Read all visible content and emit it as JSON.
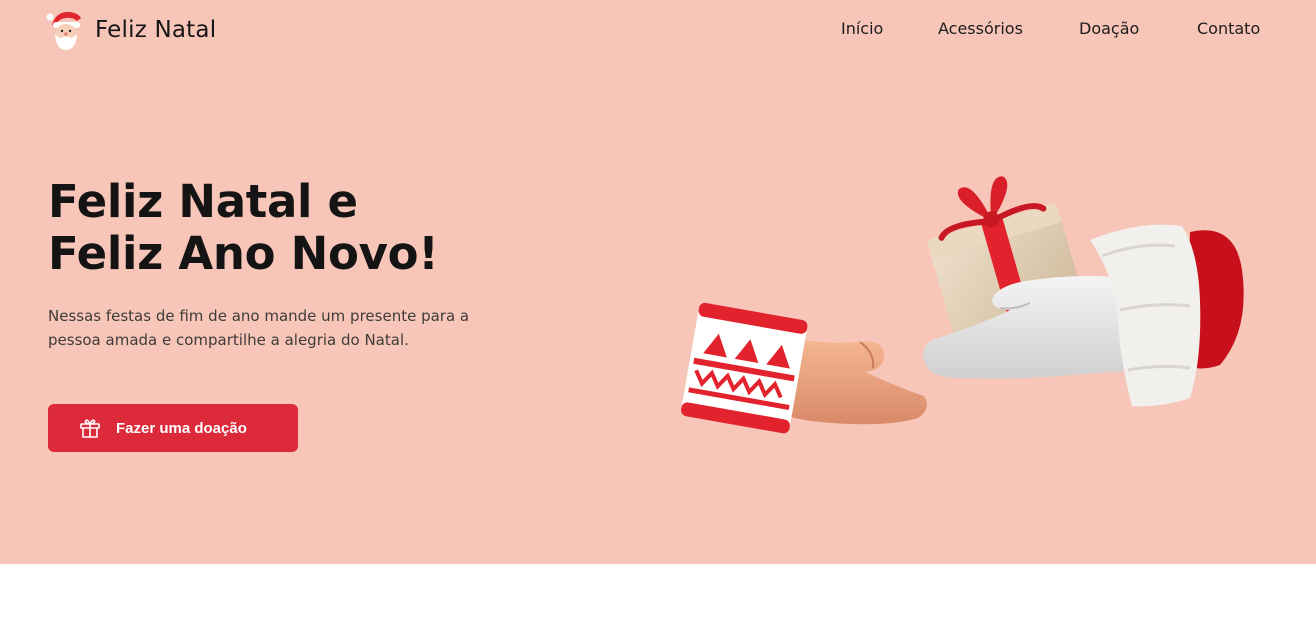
{
  "brand": {
    "name": "Feliz Natal",
    "logo_icon": "santa-icon"
  },
  "nav": {
    "items": [
      {
        "label": "Início"
      },
      {
        "label": "Acessórios"
      },
      {
        "label": "Doação"
      },
      {
        "label": "Contato"
      }
    ]
  },
  "hero": {
    "title_line_1": "Feliz Natal e",
    "title_line_2": "Feliz Ano Novo!",
    "description": "Nessas festas de fim de ano mande um presente para a pessoa amada e compartilhe a alegria do Natal.",
    "cta_label": "Fazer uma doação",
    "cta_icon": "gift-icon",
    "illustration": "gloves-giving-gift-illustration"
  },
  "colors": {
    "hero_background": "#f7c6b8",
    "accent": "#dd2a3b",
    "text": "#141414",
    "page_background": "#ffffff"
  }
}
